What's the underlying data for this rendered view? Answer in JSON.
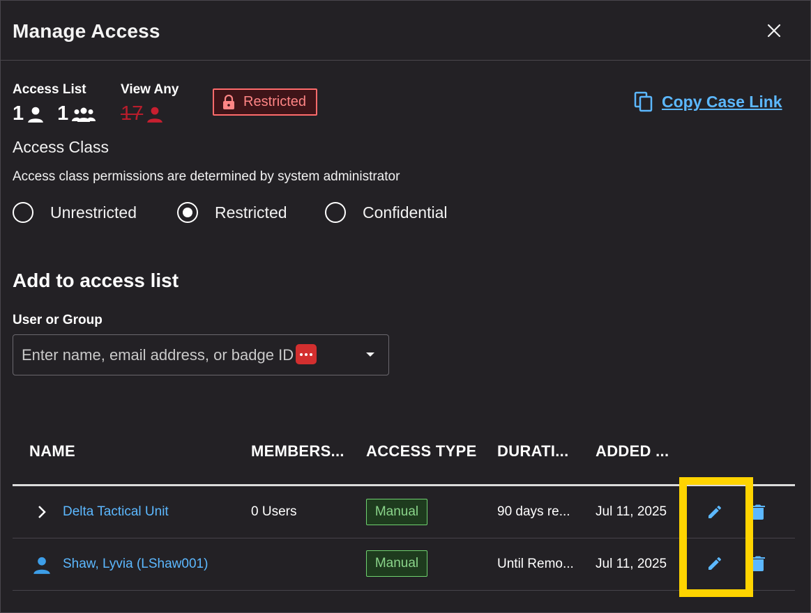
{
  "dialog": {
    "title": "Manage Access",
    "close_label": "close"
  },
  "stats": {
    "access_list_label": "Access List",
    "access_list_users": "1",
    "access_list_groups": "1",
    "view_any_label": "View Any",
    "view_any_count": "17",
    "restricted_badge": "Restricted"
  },
  "copy_link": {
    "label": "Copy Case Link"
  },
  "access_class": {
    "heading": "Access Class",
    "description": "Access class permissions are determined by system administrator",
    "options": [
      "Unrestricted",
      "Restricted",
      "Confidential"
    ],
    "selected": "Restricted"
  },
  "add_section": {
    "heading": "Add to access list",
    "field_label": "User or Group",
    "placeholder": "Enter name, email address, or badge ID"
  },
  "table": {
    "columns": [
      "NAME",
      "MEMBERS...",
      "ACCESS TYPE",
      "DURATI...",
      "ADDED ..."
    ],
    "rows": [
      {
        "name": "Delta Tactical Unit",
        "members": "0 Users",
        "access_type": "Manual",
        "duration": "90 days re...",
        "added": "Jul 11, 2025"
      },
      {
        "name": "Shaw, Lyvia (LShaw001)",
        "members": "",
        "access_type": "Manual",
        "duration": "Until Remo...",
        "added": "Jul 11, 2025"
      }
    ]
  },
  "colors": {
    "background": "#232125",
    "link": "#5cb8ff",
    "restricted": "#ff6b6b",
    "manual": "#6fd26f",
    "highlight": "#ffd400"
  }
}
